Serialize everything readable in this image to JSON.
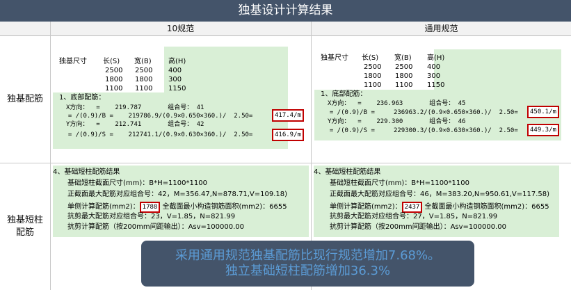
{
  "title": "独基设计计算结果",
  "columns": {
    "left": "10规范",
    "right": "通用规范"
  },
  "rows": {
    "footing": "独基配筋",
    "pier": "独基短柱配筋"
  },
  "footing_table": {
    "headers": [
      "独基尺寸",
      "长(S)",
      "宽(B)",
      "高(H)"
    ],
    "rows": [
      [
        "2500",
        "2500",
        "400"
      ],
      [
        "1800",
        "1800",
        "300"
      ],
      [
        "1100",
        "1100",
        "1150"
      ]
    ],
    "section": "1、底部配筋："
  },
  "left_footing": {
    "x_line": "X方向：  =    219.787       组合号： 41",
    "x_formula": "  = /(0.9)/B =    219786.9/(0.9×0.650×360.)/  2.50=",
    "x_result": "417.4/m",
    "y_line": "Y方向：  =    212.741       组合号： 42",
    "y_formula": "  = /(0.9)/S =    212741.1/(0.9×0.630×360.)/  2.50=",
    "y_result": "416.9/m"
  },
  "right_footing": {
    "x_line": "X方向：  =    236.963       组合号： 45",
    "x_formula": "  = /(0.9)/B =     236963.2/(0.9×0.650×360.)/  2.50=",
    "x_result": "450.1/m",
    "y_line": "Y方向：  =    229.300       组合号： 46",
    "y_formula": "  = /(0.9)/S =     229300.3/(0.9×0.630×360.)/  2.50=",
    "y_result": "449.3/m"
  },
  "pier_common": {
    "heading": "4、基础短柱配筋结果",
    "size": "基础短柱截面尺寸(mm)：B*H=1100*1100",
    "single_prefix": "单侧计算配筋(mm2)：",
    "min_area": " 全截面最小构造钢筋面积(mm2)：6655",
    "shear_note": "抗剪计算配筋（按200mm间距输出）：Asv=100000.00"
  },
  "left_pier": {
    "moment": "正截面最大配筋对应组合号：42，M=356.47,N=878.71,V=109.18)",
    "single": "1788",
    "shear": "抗剪最大配筋对应组合号：23，V=1.85，N=821.99"
  },
  "right_pier": {
    "moment": "正截面最大配筋对应组合号：46，M=383.20,N=950.61,V=117.58)",
    "single": "2437",
    "shear": "抗剪最大配筋对应组合号：27，V=1.85，N=821.99"
  },
  "note": {
    "line1": "采用通用规范独基配筋比现行规范增加7.68%。",
    "line2": "独立基础短柱配筋增加36.3%"
  },
  "colors": {
    "banner": "#44546a",
    "panel": "#d9efd6",
    "highlight": "#c00000",
    "note_text": "#5b9bd5"
  }
}
